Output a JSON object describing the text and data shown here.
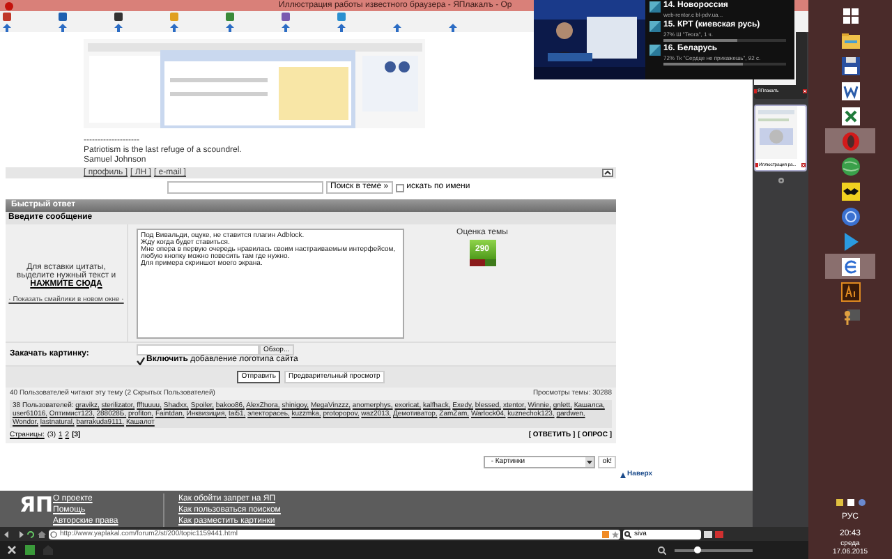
{
  "window": {
    "title": "Иллюстрация работы известного браузера - ЯПлакалъ - Op"
  },
  "post": {
    "separator": "--------------------",
    "quote": "Patriotism is the last refuge of a scoundrel.",
    "author": "Samuel Johnson",
    "links": [
      "[ профиль ]",
      "[ ЛН ]",
      "[ e-mail ]"
    ]
  },
  "search": {
    "button": "Поиск в теме »",
    "checkbox": {
      "label": "искать по имени",
      "checked": false
    }
  },
  "quick_reply": {
    "title": "Быстрый ответ",
    "subtitle": "Введите сообщение",
    "hint": "Для вставки цитаты, выделите нужный текст и",
    "hint_link": "НАЖМИТЕ СЮДА",
    "smilies_link": "· Показать смайлики в новом окне ·",
    "message": [
      "Под Вивальди, оцуке, не ставится плагин Adblock.",
      "Жду когда будет ставиться.",
      "Мне опера в первую очередь нравилась своим настраиваемым интерфейсом,",
      "любую кнопку можно повесить там где нужно.",
      "Для примера скриншот моего экрана."
    ],
    "rating": {
      "label": "Оценка темы",
      "value": "290"
    }
  },
  "upload": {
    "label": "Закачать картинку:",
    "browse": "Обзор...",
    "logo_checkbox": {
      "label": "**Включить** добавление логотипа сайта",
      "checked": true
    }
  },
  "buttons": [
    "Отправить",
    "Предварительный просмотр"
  ],
  "readers": {
    "summary": "40 Пользователей читают эту тему (2 Скрытых Пользователей)",
    "views": "Просмотры темы: 30288",
    "users_label": "38 Пользователей:",
    "users": [
      "gravikz,",
      "sterilizator,",
      "ffftuuuu,",
      "Shadxx,",
      "Spoiler,",
      "bakoo86,",
      "AlexZhora,",
      "shinigoy,",
      "MegaVinzzz,",
      "anomerphys,",
      "exoricat,",
      "kalfhack,",
      "Exedy,",
      "blessed,",
      "xtentor,",
      "Winnie,",
      "gnlett,",
      "Кашалса,",
      "user61016,",
      "Оптимист123,",
      "288028Б,",
      "profiton,",
      "Faintdan,",
      "Инквизиция,",
      "tai51,",
      "электорасеь,",
      "kuzzmka,",
      "protopopov,",
      "waz2013,",
      "Демотиватор,",
      "ZamZam,",
      "Warlock04,",
      "kuznechok123,",
      "gardwen,",
      "Wondor,",
      "lastnatural,",
      "barrakuda9111,",
      "Кашалот"
    ]
  },
  "pages": {
    "label": "Страницы:",
    "total": "(3)",
    "items": [
      {
        "label": "1",
        "selected": false
      },
      {
        "label": "2",
        "selected": false
      },
      {
        "label": "[3]",
        "selected": true
      }
    ],
    "actions": [
      "[ ОТВЕТИТЬ ]",
      "[ ОПРОС ]"
    ]
  },
  "jump": {
    "select": "- Картинки",
    "button": "ok!"
  },
  "to_top": "Наверх",
  "footer": {
    "logo": "ЯП",
    "links_1": [
      "О проекте",
      "Помощь",
      "Авторские права"
    ],
    "links_2": [
      "Как обойти запрет на ЯП",
      "Как пользоваться поиском",
      "Как разместить картинки"
    ]
  },
  "address_bar": {
    "url": "http://www.yaplakal.com/forum2/st/200/topic1159441.html",
    "search": "siva"
  },
  "status_bar": {
    "zoom": {
      "level": 0.28
    }
  },
  "side_panel": {
    "tabs": [
      {
        "title": "ЯПлакалъ",
        "selected": false
      },
      {
        "title": "Иллюстрация ра...",
        "selected": true
      }
    ]
  },
  "popup": {
    "channels": [
      {
        "title": "14. Новороссия",
        "subtitle": "web-rentor.c bl-pdv.ua..."
      },
      {
        "title": "15. КРТ (киевская русь)",
        "subtitle": "27% Ш \"Teora\", 1 ч.",
        "level": 0.6
      },
      {
        "title": "16. Беларусь",
        "subtitle": "72% Тк \"Сердце не прикажешь\", 92 с.",
        "level": 0.65
      }
    ]
  },
  "taskbar": {
    "apps": [
      {
        "kind": "windows",
        "selected": false
      },
      {
        "kind": "folder",
        "selected": false
      },
      {
        "kind": "floppy",
        "selected": false
      },
      {
        "kind": "word",
        "selected": false
      },
      {
        "kind": "excel",
        "selected": false
      },
      {
        "kind": "opera",
        "selected": true
      },
      {
        "kind": "globe",
        "selected": false
      },
      {
        "kind": "bat",
        "selected": false
      },
      {
        "kind": "bluecircle",
        "selected": false
      },
      {
        "kind": "play",
        "selected": false
      },
      {
        "kind": "edge",
        "selected": true
      },
      {
        "kind": "ai",
        "selected": false
      },
      {
        "kind": "figure",
        "selected": false
      }
    ],
    "lang": "РУС",
    "time": "20:43",
    "day": "среда",
    "date": "17.06.2015"
  }
}
